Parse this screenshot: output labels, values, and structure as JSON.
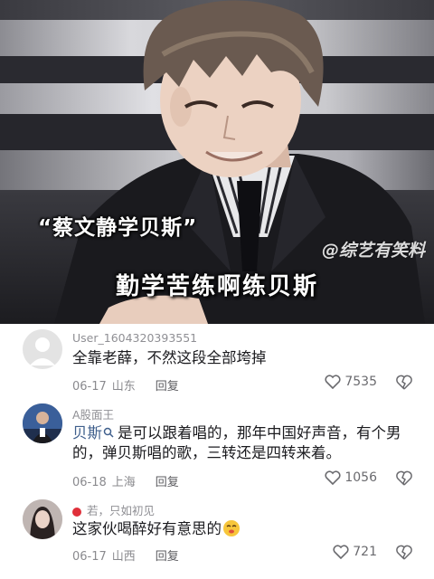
{
  "video": {
    "subtitle_top": "“蔡文静学贝斯”",
    "subtitle_main": "勤学苦练啊练贝斯",
    "watermark": "@综艺有笑料"
  },
  "comments": [
    {
      "username": "User_1604320393551",
      "text": "全靠老薛，不然这段全部垮掉",
      "date": "06-17",
      "location": "山东",
      "reply_label": "回复",
      "likes": "7535",
      "avatar": "default-avatar"
    },
    {
      "username": "A股面王",
      "mention_name": "贝斯",
      "text": "是可以跟着唱的，那年中国好声音，有个男的，弹贝斯唱的歌，三转还是四转来着。",
      "date": "06-18",
      "location": "上海",
      "reply_label": "回复",
      "likes": "1056",
      "avatar": "news-anchor-avatar"
    },
    {
      "username": "若，只如初见",
      "text": "这家伙喝醉好有意思的",
      "date": "06-17",
      "location": "山西",
      "reply_label": "回复",
      "likes": "721",
      "avatar": "woman-avatar"
    }
  ],
  "colors": {
    "username": "#8f8f94",
    "text": "#1b1b1f",
    "meta": "#8a8a8e",
    "mention": "#3f5f8c"
  }
}
